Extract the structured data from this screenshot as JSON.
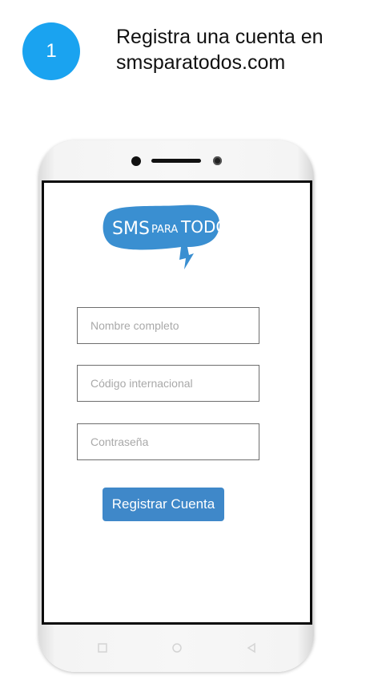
{
  "step": {
    "number": "1",
    "text": "Registra una cuenta en smsparatodos.com"
  },
  "logo": {
    "text_sms": "SMS",
    "text_para": "PARA",
    "text_todos": "TODOS",
    "color": "#3a8fd1"
  },
  "form": {
    "fields": [
      {
        "placeholder": "Nombre completo"
      },
      {
        "placeholder": "Código internacional"
      },
      {
        "placeholder": "Contraseña"
      }
    ],
    "submit_label": "Registrar Cuenta"
  },
  "navbar": {
    "icons": [
      "recent-apps-icon",
      "home-icon",
      "back-icon"
    ]
  },
  "colors": {
    "step_circle": "#1aa3f0",
    "button": "#3f88c9"
  }
}
